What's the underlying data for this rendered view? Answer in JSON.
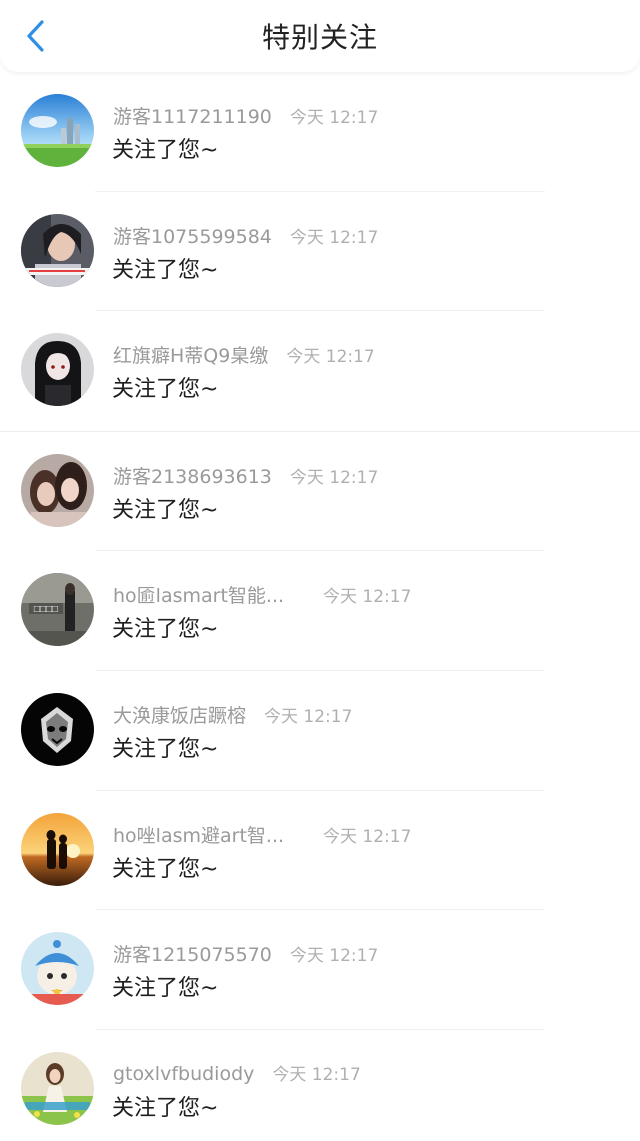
{
  "header": {
    "title": "特别关注",
    "back_icon": "chevron-left-icon",
    "accent_color": "#2f8fe6"
  },
  "items": [
    {
      "name": "游客1117211190",
      "time": "今天 12:17",
      "message": "关注了您~",
      "avatar": "sky-landscape"
    },
    {
      "name": "游客1075599584",
      "time": "今天 12:17",
      "message": "关注了您~",
      "avatar": "girl-portrait"
    },
    {
      "name": "红旗癖H蒂Q9臬缴",
      "time": "今天 12:17",
      "message": "关注了您~",
      "avatar": "anime-girl"
    },
    {
      "name": "游客2138693613",
      "time": "今天 12:17",
      "message": "关注了您~",
      "avatar": "two-girls"
    },
    {
      "name": "ho匬lasmart智能...",
      "time": "今天 12:17",
      "message": "关注了您~",
      "avatar": "street-photo"
    },
    {
      "name": "大涣康饭店蹶榕",
      "time": "今天 12:17",
      "message": "关注了您~",
      "avatar": "skull-logo"
    },
    {
      "name": "ho唑lasm避art智...",
      "time": "今天 12:17",
      "message": "关注了您~",
      "avatar": "sunset-couple"
    },
    {
      "name": "游客1215075570",
      "time": "今天 12:17",
      "message": "关注了您~",
      "avatar": "cat-hat"
    },
    {
      "name": "gtoxlvfbudiody",
      "time": "今天 12:17",
      "message": "关注了您~",
      "avatar": "girl-flowers"
    }
  ]
}
